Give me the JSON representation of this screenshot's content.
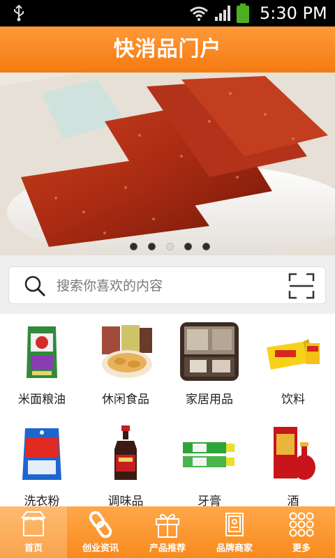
{
  "status_bar": {
    "time": "5:30 PM"
  },
  "header": {
    "title": "快消品门户"
  },
  "banner": {
    "slide_count": 5,
    "active_index": 2
  },
  "search": {
    "placeholder": "搜索你喜欢的内容"
  },
  "categories": [
    {
      "label": "米面粮油",
      "icon": "rice-bag-image"
    },
    {
      "label": "休闲食品",
      "icon": "snack-food-image"
    },
    {
      "label": "家居用品",
      "icon": "furniture-image"
    },
    {
      "label": "饮料",
      "icon": "drink-box-image"
    },
    {
      "label": "洗衣粉",
      "icon": "detergent-image"
    },
    {
      "label": "调味品",
      "icon": "soy-sauce-image"
    },
    {
      "label": "牙膏",
      "icon": "toothpaste-image"
    },
    {
      "label": "酒",
      "icon": "liquor-image"
    }
  ],
  "tabs": [
    {
      "label": "首页",
      "icon": "home-icon",
      "active": true
    },
    {
      "label": "创业资讯",
      "icon": "link-icon",
      "active": false
    },
    {
      "label": "产品推荐",
      "icon": "gift-icon",
      "active": false
    },
    {
      "label": "品牌商家",
      "icon": "book-icon",
      "active": false
    },
    {
      "label": "更多",
      "icon": "grid-dots-icon",
      "active": false
    }
  ],
  "colors": {
    "accent": "#f88a1c",
    "header": "#f47a10"
  }
}
